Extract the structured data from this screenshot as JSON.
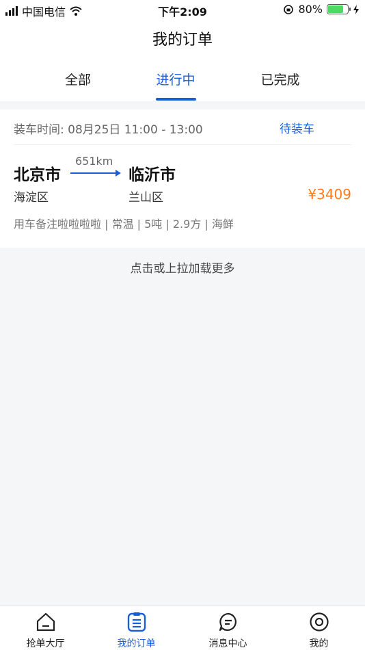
{
  "status_bar": {
    "carrier": "中国电信",
    "time": "下午2:09",
    "battery_percent": "80%",
    "battery_level": 0.8
  },
  "nav": {
    "title": "我的订单"
  },
  "tabs": [
    {
      "label": "全部",
      "active": false
    },
    {
      "label": "进行中",
      "active": true
    },
    {
      "label": "已完成",
      "active": false
    }
  ],
  "order": {
    "load_time": "装车时间: 08月25日 11:00 - 13:00",
    "status": "待装车",
    "from_city": "北京市",
    "from_district": "海淀区",
    "to_city": "临沂市",
    "to_district": "兰山区",
    "distance": "651km",
    "price": "¥3409",
    "remark": "用车备注啦啦啦啦 | 常温 | 5吨 | 2.9方 | 海鲜"
  },
  "load_more": "点击或上拉加载更多",
  "tabbar": [
    {
      "label": "抢单大厅",
      "icon": "home-icon",
      "active": false
    },
    {
      "label": "我的订单",
      "icon": "order-list-icon",
      "active": true
    },
    {
      "label": "消息中心",
      "icon": "message-icon",
      "active": false
    },
    {
      "label": "我的",
      "icon": "profile-icon",
      "active": false
    }
  ],
  "colors": {
    "accent": "#1a5dd9",
    "price": "#ff7a1a"
  }
}
